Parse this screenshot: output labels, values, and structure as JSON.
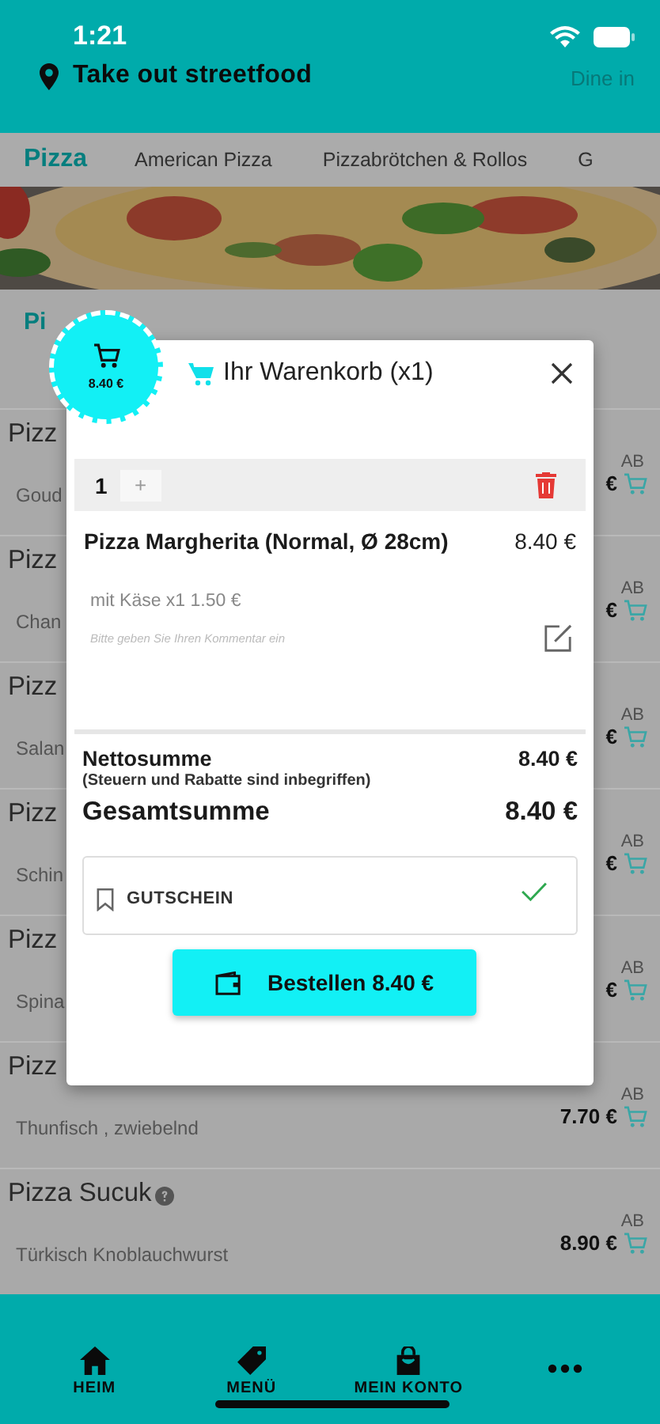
{
  "status_bar": {
    "time": "1:21"
  },
  "header": {
    "location": "Take out streetfood",
    "mode_button": "Dine in"
  },
  "tabs": [
    {
      "label": "Pizza",
      "selected": true
    },
    {
      "label": "American Pizza",
      "selected": false
    },
    {
      "label": "Pizzabrötchen & Rollos",
      "selected": false
    },
    {
      "label": "G",
      "selected": false
    }
  ],
  "section": {
    "title": "Pi"
  },
  "products": [
    {
      "name": "Pizz",
      "info": false,
      "description": "Goud",
      "unit": "AB",
      "price": "€"
    },
    {
      "name": "Pizz",
      "info": false,
      "description": "Chan",
      "unit": "AB",
      "price": "€"
    },
    {
      "name": "Pizz",
      "info": false,
      "description": "Salan",
      "unit": "AB",
      "price": "€"
    },
    {
      "name": "Pizz",
      "info": false,
      "description": "Schin",
      "unit": "AB",
      "price": "€"
    },
    {
      "name": "Pizz",
      "info": false,
      "description": "Spina",
      "unit": "AB",
      "price": "€"
    },
    {
      "name": "Pizz",
      "info": false,
      "description": "Thunfisch , zwiebelnd",
      "unit": "AB",
      "price": "7.70 €"
    },
    {
      "name": "Pizza Sucuk",
      "info": true,
      "description": "Türkisch Knoblauchwurst",
      "unit": "AB",
      "price": "8.90 €"
    }
  ],
  "cart_bubble": {
    "total": "8.40 €"
  },
  "cart_dialog": {
    "title": "Ihr Warenkorb (x1)",
    "item": {
      "quantity": "1",
      "plus": "+",
      "name": "Pizza Margherita (Normal, Ø 28cm)",
      "price": "8.40 €",
      "extra": "mit Käse x1 1.50 €",
      "comment_placeholder": "Bitte geben Sie Ihren Kommentar ein"
    },
    "net_label": "Nettosumme",
    "net_value": "8.40 €",
    "net_note": "(Steuern und Rabatte sind inbegriffen)",
    "total_label": "Gesamtsumme",
    "total_value": "8.40 €",
    "voucher": {
      "label": "GUTSCHEIN",
      "applied": true
    },
    "order_button": "Bestellen 8.40 €"
  },
  "bottom_nav": [
    {
      "kind": "home",
      "label": "HEIM"
    },
    {
      "kind": "tag",
      "label": "MENÜ"
    },
    {
      "kind": "bag",
      "label": "MEIN KONTO"
    },
    {
      "kind": "more"
    }
  ]
}
